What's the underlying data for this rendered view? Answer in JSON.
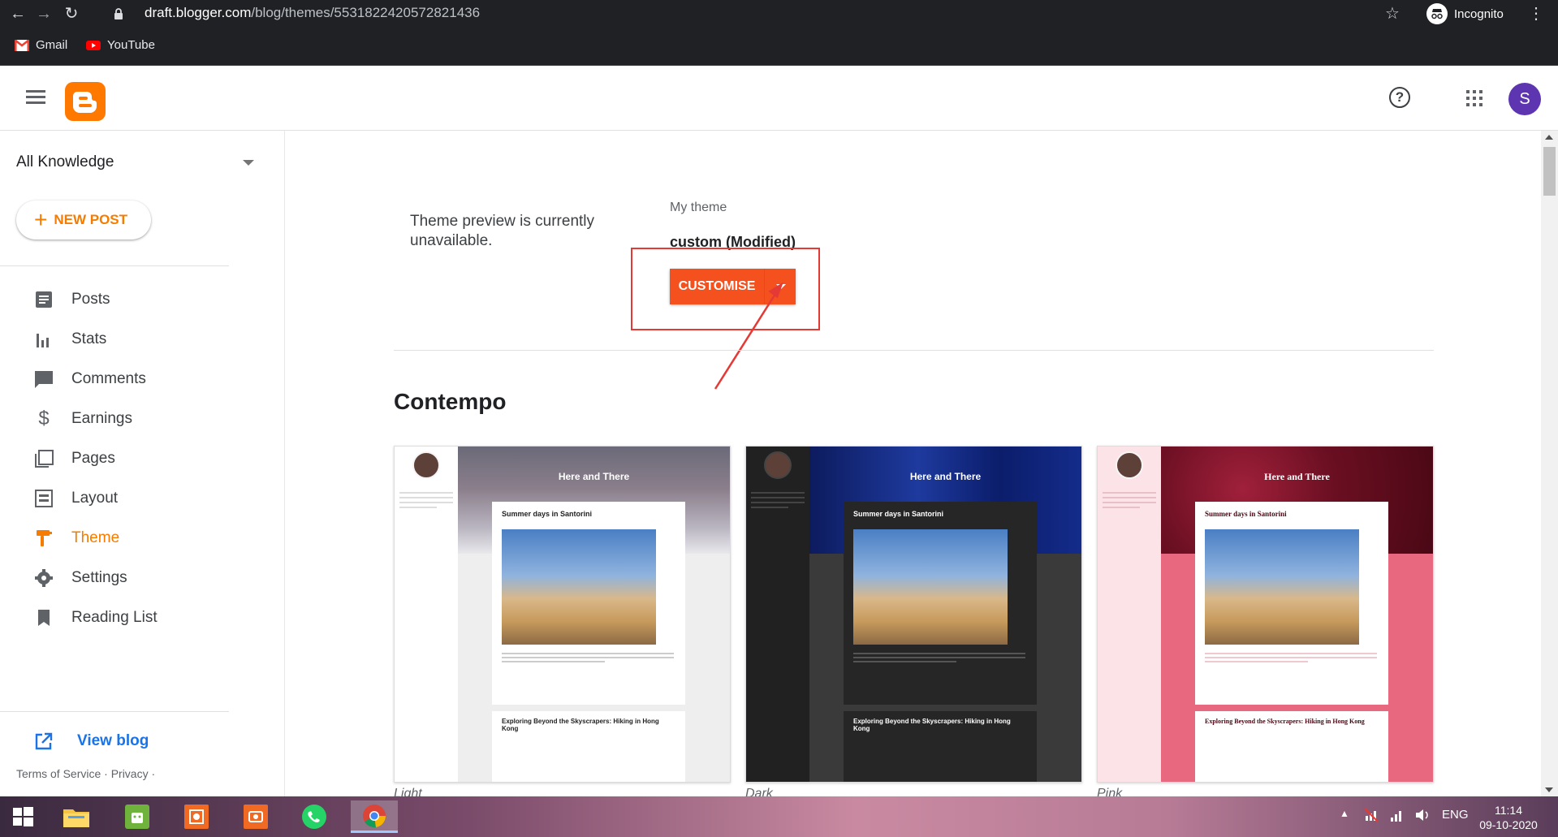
{
  "browser": {
    "url_host": "draft.blogger.com",
    "url_path": "/blog/themes/5531822420572821436",
    "profile_label": "Incognito",
    "bookmarks": [
      {
        "label": "Gmail",
        "icon": "gmail-icon"
      },
      {
        "label": "YouTube",
        "icon": "youtube-icon"
      }
    ]
  },
  "header": {
    "avatar_letter": "S",
    "help_symbol": "?",
    "brand_color": "#ff7900"
  },
  "sidebar": {
    "blog_name": "All Knowledge",
    "new_post_label": "NEW POST",
    "items": [
      {
        "label": "Posts",
        "icon": "posts-icon"
      },
      {
        "label": "Stats",
        "icon": "stats-icon"
      },
      {
        "label": "Comments",
        "icon": "comments-icon"
      },
      {
        "label": "Earnings",
        "icon": "earnings-icon"
      },
      {
        "label": "Pages",
        "icon": "pages-icon"
      },
      {
        "label": "Layout",
        "icon": "layout-icon"
      },
      {
        "label": "Theme",
        "icon": "theme-icon",
        "active": true
      },
      {
        "label": "Settings",
        "icon": "settings-icon"
      },
      {
        "label": "Reading List",
        "icon": "bookmark-icon"
      }
    ],
    "view_blog_label": "View blog",
    "footer": "Terms of Service · Privacy ·",
    "accent_color": "#f57c00"
  },
  "main": {
    "preview_message": "Theme preview is currently unavailable.",
    "my_theme_label": "My theme",
    "theme_name": "custom (Modified)",
    "customise_label": "CUSTOMISE",
    "section_title": "Contempo",
    "cards": [
      {
        "caption": "Light",
        "blog_title": "Here and There",
        "post_title": "Summer days in Santorini",
        "post2_title": "Exploring Beyond the Skyscrapers: Hiking in Hong Kong"
      },
      {
        "caption": "Dark",
        "blog_title": "Here and There",
        "post_title": "Summer days in Santorini",
        "post2_title": "Exploring Beyond the Skyscrapers: Hiking in Hong Kong"
      },
      {
        "caption": "Pink",
        "blog_title": "Here and There",
        "post_title": "Summer days in Santorini",
        "post2_title": "Exploring Beyond the Skyscrapers: Hiking in Hong Kong"
      }
    ],
    "button_color": "#f4511e",
    "annotation_color": "#e53935"
  },
  "taskbar": {
    "language": "ENG",
    "time": "11:14",
    "date": "09-10-2020"
  }
}
